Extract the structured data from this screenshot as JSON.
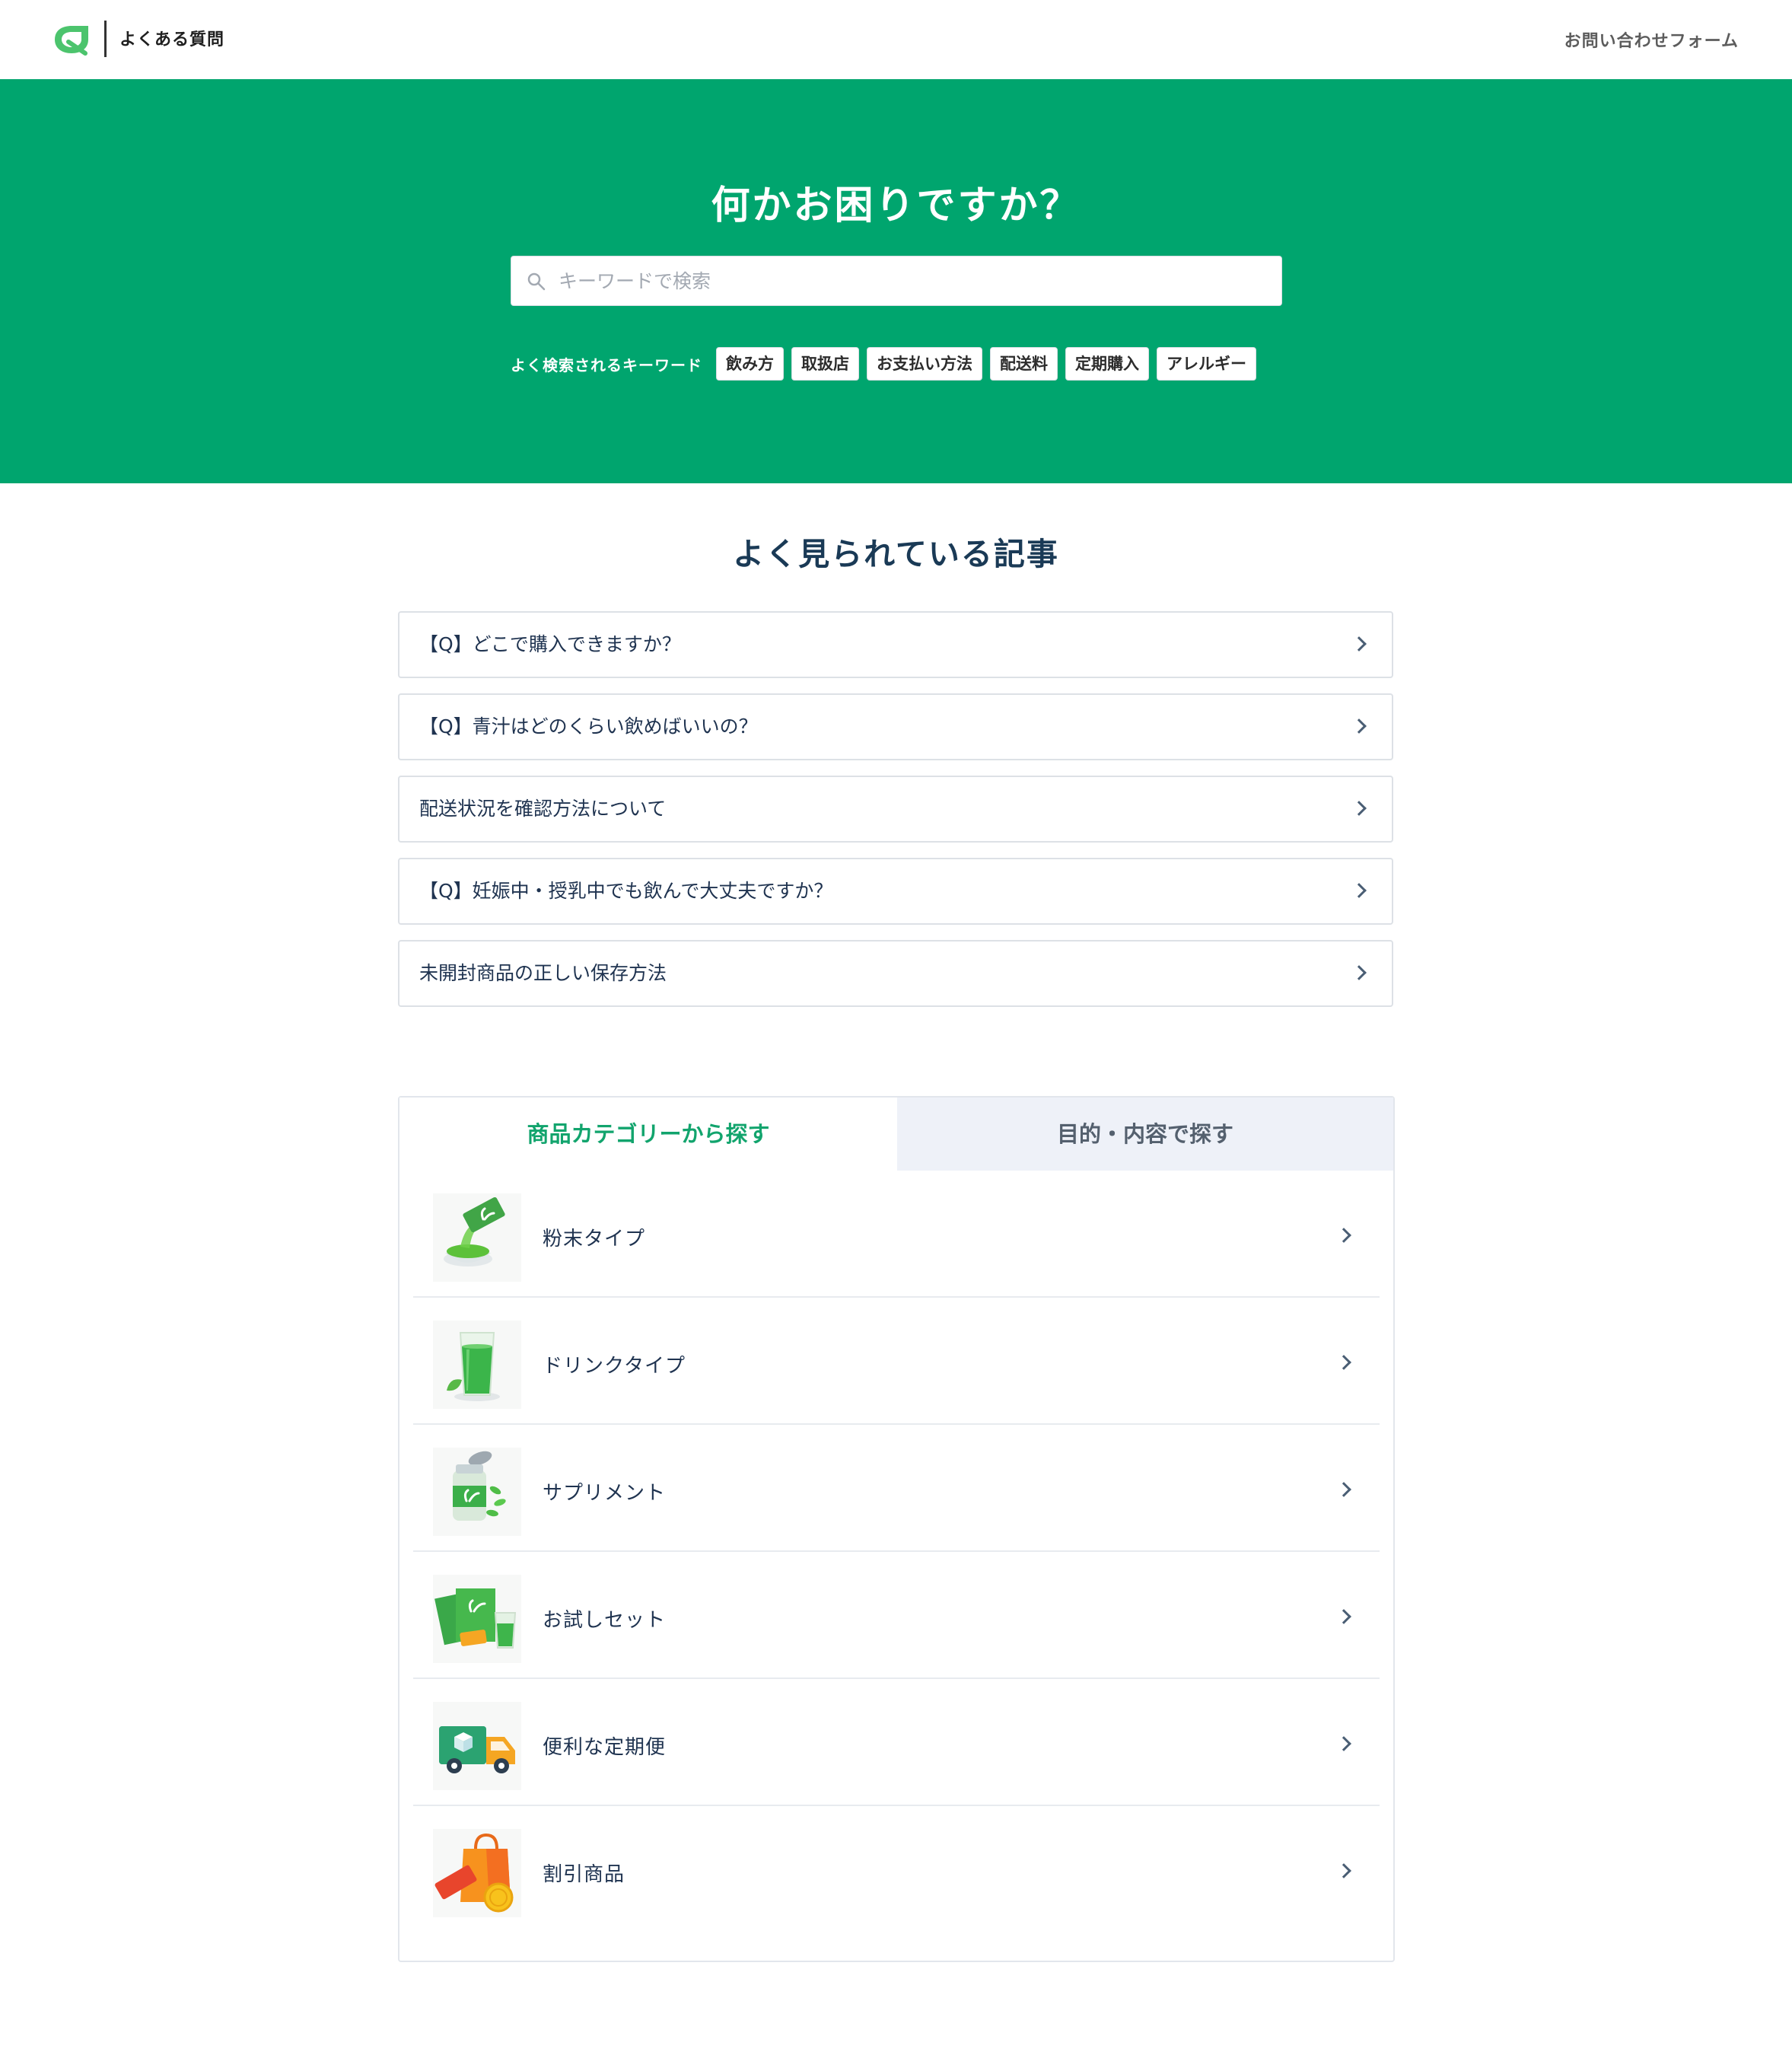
{
  "header": {
    "brand": "よくある質問",
    "contact": "お問い合わせフォーム"
  },
  "hero": {
    "title": "何かお困りですか？",
    "search_placeholder": "キーワードで検索",
    "keywords_label": "よく検索されるキーワード",
    "keywords": [
      "飲み方",
      "取扱店",
      "お支払い方法",
      "配送料",
      "定期購入",
      "アレルギー"
    ]
  },
  "popular": {
    "title": "よく見られている記事",
    "articles": [
      "【Q】どこで購入できますか？",
      "【Q】青汁はどのくらい飲めばいいの？",
      "配送状況を確認方法について",
      "【Q】妊娠中・授乳中でも飲んで大丈夫ですか？",
      "未開封商品の正しい保存方法"
    ]
  },
  "tabs": {
    "active": "商品カテゴリーから探す",
    "inactive": "目的・内容で探す"
  },
  "categories": [
    {
      "label": "粉末タイプ",
      "icon": "powder-icon"
    },
    {
      "label": "ドリンクタイプ",
      "icon": "drink-icon"
    },
    {
      "label": "サプリメント",
      "icon": "supplement-icon"
    },
    {
      "label": "お試しセット",
      "icon": "trial-set-icon"
    },
    {
      "label": "便利な定期便",
      "icon": "delivery-truck-icon"
    },
    {
      "label": "割引商品",
      "icon": "sale-bag-icon"
    }
  ],
  "colors": {
    "brand_green": "#00a56e",
    "tab_active_text": "#12a46d",
    "tab_inactive_bg": "#eef1f8"
  }
}
